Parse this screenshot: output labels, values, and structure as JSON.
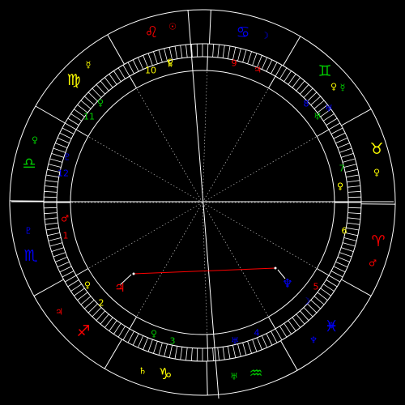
{
  "colors": {
    "background": "#000000",
    "line": "#ffffff",
    "fire": "#ff0000",
    "earth": "#ffff00",
    "air": "#00cc00",
    "water": "#0000ff",
    "aspect_opposition": "#ff0000"
  },
  "signs": [
    {
      "glyph": "♈",
      "name": "Aries",
      "color": "#ff0000"
    },
    {
      "glyph": "♉",
      "name": "Taurus",
      "color": "#ffff00"
    },
    {
      "glyph": "♊",
      "name": "Gemini",
      "color": "#00cc00"
    },
    {
      "glyph": "♋",
      "name": "Cancer",
      "color": "#0000ff"
    },
    {
      "glyph": "♌",
      "name": "Leo",
      "color": "#ff0000"
    },
    {
      "glyph": "♍",
      "name": "Virgo",
      "color": "#ffff00"
    },
    {
      "glyph": "♎",
      "name": "Libra",
      "color": "#00cc00"
    },
    {
      "glyph": "♏",
      "name": "Scorpio",
      "color": "#0000ff"
    },
    {
      "glyph": "♐",
      "name": "Sagittarius",
      "color": "#ff0000"
    },
    {
      "glyph": "♑",
      "name": "Capricorn",
      "color": "#ffff00"
    },
    {
      "glyph": "♒",
      "name": "Aquarius",
      "color": "#00cc00"
    },
    {
      "glyph": "♓",
      "name": "Pisces",
      "color": "#0000ff"
    }
  ],
  "house_numbers": [
    {
      "label": "1",
      "color": "#ff0000"
    },
    {
      "label": "2",
      "color": "#ffff00"
    },
    {
      "label": "3",
      "color": "#00cc00"
    },
    {
      "label": "4",
      "color": "#0000ff"
    },
    {
      "label": "5",
      "color": "#ff0000"
    },
    {
      "label": "6",
      "color": "#ffff00"
    },
    {
      "label": "7",
      "color": "#00cc00"
    },
    {
      "label": "8",
      "color": "#0000ff"
    },
    {
      "label": "9",
      "color": "#ff0000"
    },
    {
      "label": "10",
      "color": "#ffff00"
    },
    {
      "label": "11",
      "color": "#00cc00"
    },
    {
      "label": "12",
      "color": "#0000ff"
    }
  ],
  "rulers": [
    {
      "glyph": "♂",
      "color": "#ff0000"
    },
    {
      "glyph": "♀",
      "color": "#ffff00"
    },
    {
      "glyph": "☿",
      "color": "#00cc00"
    },
    {
      "glyph": "☽",
      "color": "#0000ff"
    },
    {
      "glyph": "☉",
      "color": "#ff0000"
    },
    {
      "glyph": "☿",
      "color": "#ffff00"
    },
    {
      "glyph": "♀",
      "color": "#00cc00"
    },
    {
      "glyph": "♇",
      "color": "#0000ff"
    },
    {
      "glyph": "♃",
      "color": "#ff0000"
    },
    {
      "glyph": "♄",
      "color": "#ffff00"
    },
    {
      "glyph": "♅",
      "color": "#00cc00"
    },
    {
      "glyph": "♆",
      "color": "#0000ff"
    }
  ],
  "planets": [
    {
      "glyph": "♂",
      "name": "Mars",
      "color": "#ff0000"
    },
    {
      "glyph": "♃",
      "name": "Jupiter",
      "color": "#ff0000"
    },
    {
      "glyph": "♆",
      "name": "Neptune",
      "color": "#0000ff"
    },
    {
      "glyph": "☽",
      "name": "Moon",
      "color": "#0000ff"
    },
    {
      "glyph": "♀",
      "name": "Venus",
      "color": "#00cc00"
    },
    {
      "glyph": "♀",
      "name": "Venus",
      "color": "#ffff00"
    },
    {
      "glyph": "♄",
      "name": "Saturn",
      "color": "#ffff00"
    },
    {
      "glyph": "♃",
      "name": "Jupiter",
      "color": "#ff0000"
    },
    {
      "glyph": "♇",
      "name": "Pluto",
      "color": "#0000ff"
    },
    {
      "glyph": "♅",
      "name": "Uranus",
      "color": "#0000ff"
    },
    {
      "glyph": "♅",
      "name": "Uranus",
      "color": "#00cc00"
    },
    {
      "glyph": "♀",
      "name": "Venus",
      "color": "#ffff00"
    },
    {
      "glyph": "♀",
      "name": "Venus",
      "color": "#ffff00"
    }
  ]
}
